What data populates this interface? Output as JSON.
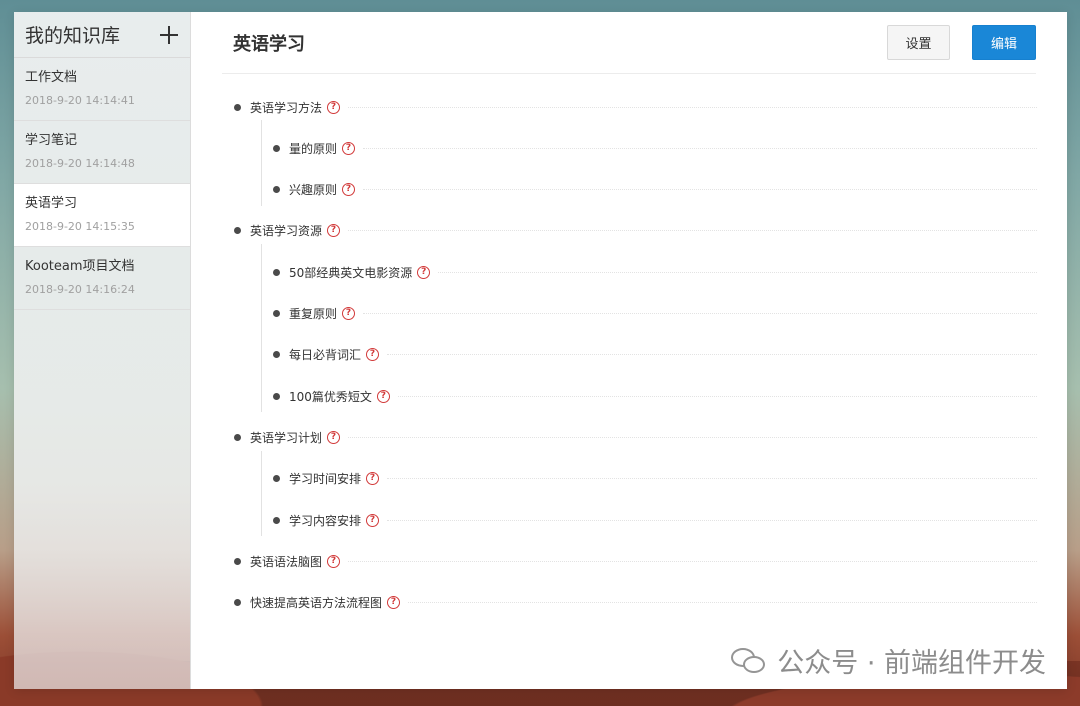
{
  "sidebar": {
    "title": "我的知识库",
    "add_icon": "plus-icon",
    "items": [
      {
        "name": "工作文档",
        "time": "2018-9-20 14:14:41"
      },
      {
        "name": "学习笔记",
        "time": "2018-9-20 14:14:48"
      },
      {
        "name": "英语学习",
        "time": "2018-9-20 14:15:35"
      },
      {
        "name": "Kooteam项目文档",
        "time": "2018-9-20 14:16:24"
      }
    ]
  },
  "header": {
    "title": "英语学习",
    "settings_label": "设置",
    "edit_label": "编辑"
  },
  "tree": {
    "help_glyph": "?",
    "nodes": [
      {
        "label": "英语学习方法",
        "level": 1
      },
      {
        "label": "量的原则",
        "level": 2
      },
      {
        "label": "兴趣原则",
        "level": 2
      },
      {
        "label": "英语学习资源",
        "level": 1
      },
      {
        "label": "50部经典英文电影资源",
        "level": 2
      },
      {
        "label": "重复原则",
        "level": 2
      },
      {
        "label": "每日必背词汇",
        "level": 2
      },
      {
        "label": "100篇优秀短文",
        "level": 2
      },
      {
        "label": "英语学习计划",
        "level": 1
      },
      {
        "label": "学习时间安排",
        "level": 2
      },
      {
        "label": "学习内容安排",
        "level": 2
      },
      {
        "label": "英语语法脑图",
        "level": 1
      },
      {
        "label": "快速提高英语方法流程图",
        "level": 1
      }
    ]
  },
  "watermark": {
    "text": "公众号 · 前端组件开发",
    "icon": "wechat-icon"
  },
  "colors": {
    "accent": "#1a87d7",
    "help_icon": "#d23a3a"
  }
}
